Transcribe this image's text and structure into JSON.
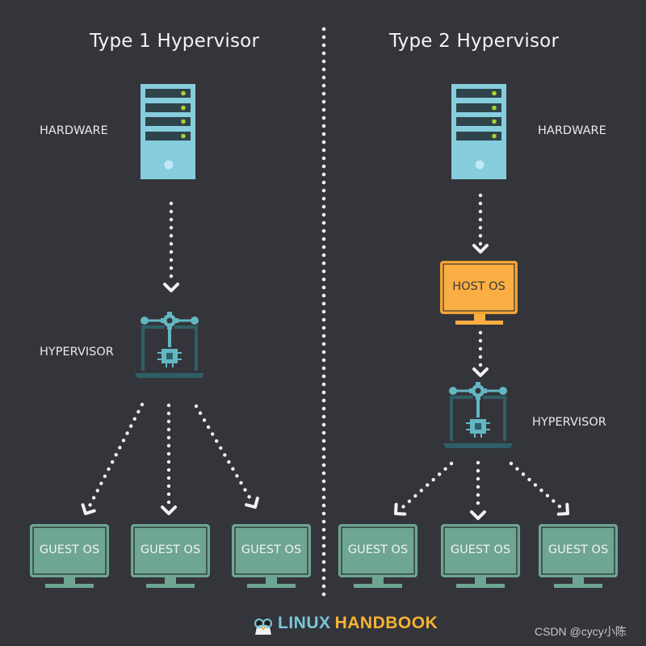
{
  "diagram": {
    "left": {
      "title": "Type 1 Hypervisor",
      "hardware_label": "HARDWARE",
      "hypervisor_label": "HYPERVISOR",
      "guests": [
        "GUEST OS",
        "GUEST OS",
        "GUEST OS"
      ]
    },
    "right": {
      "title": "Type 2 Hypervisor",
      "hardware_label": "HARDWARE",
      "host_label": "HOST OS",
      "hypervisor_label": "HYPERVISOR",
      "guests": [
        "GUEST OS",
        "GUEST OS",
        "GUEST OS"
      ]
    },
    "icons": {
      "hardware": "server-tower-icon",
      "hypervisor": "hypervisor-laptop-chip-icon",
      "host": "monitor-icon",
      "guest": "monitor-icon",
      "brand": "penguin-glasses-icon"
    },
    "colors": {
      "background": "#34353a",
      "server": "#86cdde",
      "server_slot": "#2f434b",
      "server_led": "#a8d234",
      "server_button": "#c4e6f7",
      "hypervisor_light": "#63b7c2",
      "hypervisor_dark": "#2e5f66",
      "host_fill": "#fbae43",
      "host_text": "#3b3b3b",
      "guest_fill": "#6fa593",
      "guest_border": "#1f2a27",
      "guest_text": "#eef4f1",
      "arrow": "#f2f2f2",
      "brand_linux": "#79c7d8",
      "brand_handbook": "#f6b333"
    }
  },
  "brand": {
    "linux": "LINUX",
    "handbook": "HANDBOOK"
  },
  "watermark": "CSDN @cycy小陈"
}
